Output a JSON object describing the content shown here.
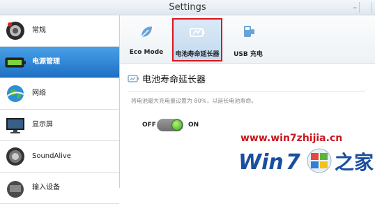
{
  "window": {
    "title": "Settings",
    "minimize_glyph": "–"
  },
  "sidebar": {
    "items": [
      {
        "label": "常规",
        "icon": "speaker-icon",
        "active": false
      },
      {
        "label": "电源管理",
        "icon": "battery-icon",
        "active": true
      },
      {
        "label": "网络",
        "icon": "globe-icon",
        "active": false
      },
      {
        "label": "显示屏",
        "icon": "monitor-icon",
        "active": false
      },
      {
        "label": "SoundAlive",
        "icon": "sound-icon",
        "active": false
      },
      {
        "label": "输入设备",
        "icon": "keyboard-icon",
        "active": false
      }
    ]
  },
  "toolbar": {
    "tabs": [
      {
        "label": "Eco Mode",
        "icon": "leaf-icon",
        "selected": false
      },
      {
        "label": "电池寿命延长器",
        "icon": "battery-extender-icon",
        "selected": true
      },
      {
        "label": "USB 充电",
        "icon": "usb-icon",
        "selected": false
      }
    ]
  },
  "content": {
    "heading": "电池寿命延长器",
    "description": "将电池最大充电量设置为 80%，以延长电池寿命。",
    "toggle": {
      "off_label": "OFF",
      "on_label": "ON",
      "state": "on"
    }
  },
  "watermark": {
    "url": "www.win7zhijia.cn",
    "logo_text": "Win7之家"
  },
  "colors": {
    "accent_blue": "#1e6fc4",
    "selection_border": "#d9161c",
    "toggle_green": "#3da91e",
    "watermark_red": "#c8171d",
    "watermark_blue": "#1a4fa0"
  }
}
